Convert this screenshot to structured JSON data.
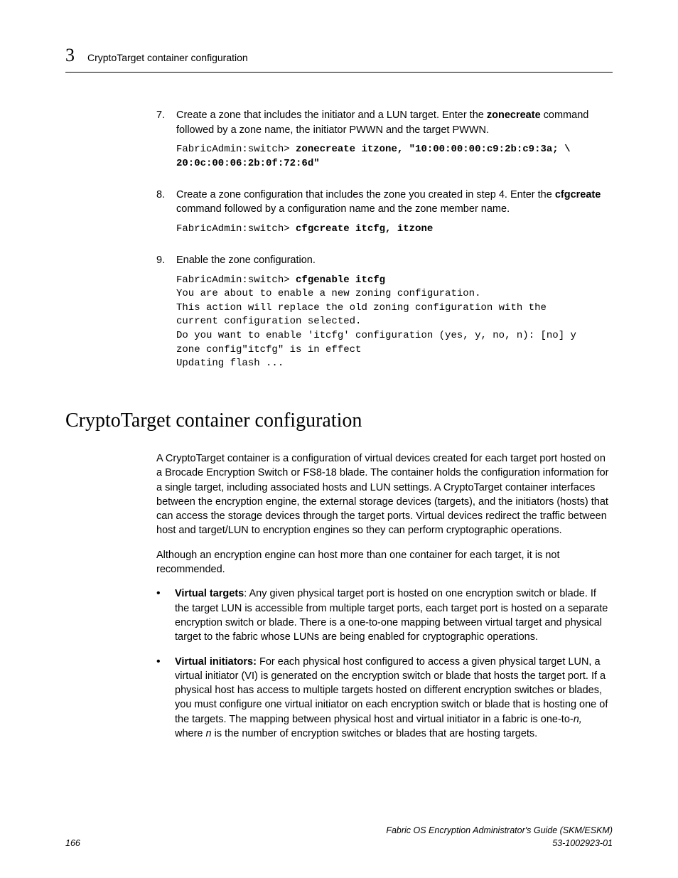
{
  "header": {
    "chapter_num": "3",
    "section_title": "CryptoTarget container configuration"
  },
  "steps": {
    "s7": {
      "num": "7.",
      "text_a": "Create a zone that includes the initiator and a LUN target. Enter the ",
      "cmd_a": "zonecreate",
      "text_b": " command followed by a zone name, the initiator PWWN and the target PWWN.",
      "code_prompt": "FabricAdmin:switch> ",
      "code_bold_l1": "zonecreate itzone, \"10:00:00:00:c9:2b:c9:3a; \\",
      "code_bold_l2": "20:0c:00:06:2b:0f:72:6d\""
    },
    "s8": {
      "num": "8.",
      "text_a": "Create a zone configuration that includes the zone you created in step 4. Enter the ",
      "cmd_a": "cfgcreate",
      "text_b": " command followed by a configuration name and the zone member name.",
      "code_prompt": "FabricAdmin:switch> ",
      "code_bold": "cfgcreate itcfg, itzone"
    },
    "s9": {
      "num": "9.",
      "text": "Enable the zone configuration.",
      "code_prompt": "FabricAdmin:switch> ",
      "code_bold": "cfgenable itcfg",
      "code_l2": "You are about to enable a new zoning configuration.",
      "code_l3": "This action will replace the old zoning configuration with the",
      "code_l4": "current configuration selected.",
      "code_l5": "Do you want to enable 'itcfg' configuration (yes, y, no, n): [no] y",
      "code_l6": "zone config\"itcfg\" is in effect",
      "code_l7": "Updating flash ..."
    }
  },
  "main_heading": "CryptoTarget container configuration",
  "body": {
    "p1": "A CryptoTarget container is a configuration of virtual devices created for each target port hosted on a Brocade Encryption Switch or FS8-18 blade. The container holds the configuration information for a single target, including associated hosts and LUN settings. A CryptoTarget container interfaces between the encryption engine, the external storage devices (targets), and the initiators (hosts) that can access the storage devices through the target ports. Virtual devices redirect the traffic between host and target/LUN to encryption engines so they can perform cryptographic operations.",
    "p2": "Although an encryption engine can host more than one container for each target, it is not recommended.",
    "b1_label": "Virtual targets",
    "b1_text": ": Any given physical target port is hosted on one encryption switch or blade. If the target LUN is accessible from multiple target ports, each target port is hosted on a separate encryption switch or blade. There is a one-to-one mapping between virtual target and physical target to the fabric whose LUNs are being enabled for cryptographic operations.",
    "b2_label": "Virtual initiators:",
    "b2_text_a": " For each physical host configured to access a given physical target LUN, a virtual initiator (VI) is generated on the encryption switch or blade that hosts the target port. If a physical host has access to multiple targets hosted on different encryption switches or blades, you must configure one virtual initiator on each encryption switch or blade that is hosting one of the targets. The mapping between physical host and virtual initiator in a fabric is one-to-",
    "b2_n1": "n,",
    "b2_text_b": " where ",
    "b2_n2": "n",
    "b2_text_c": " is the number of encryption switches or blades that are hosting targets."
  },
  "footer": {
    "page_num": "166",
    "doc_title": "Fabric OS Encryption Administrator's Guide (SKM/ESKM)",
    "doc_id": "53-1002923-01"
  }
}
